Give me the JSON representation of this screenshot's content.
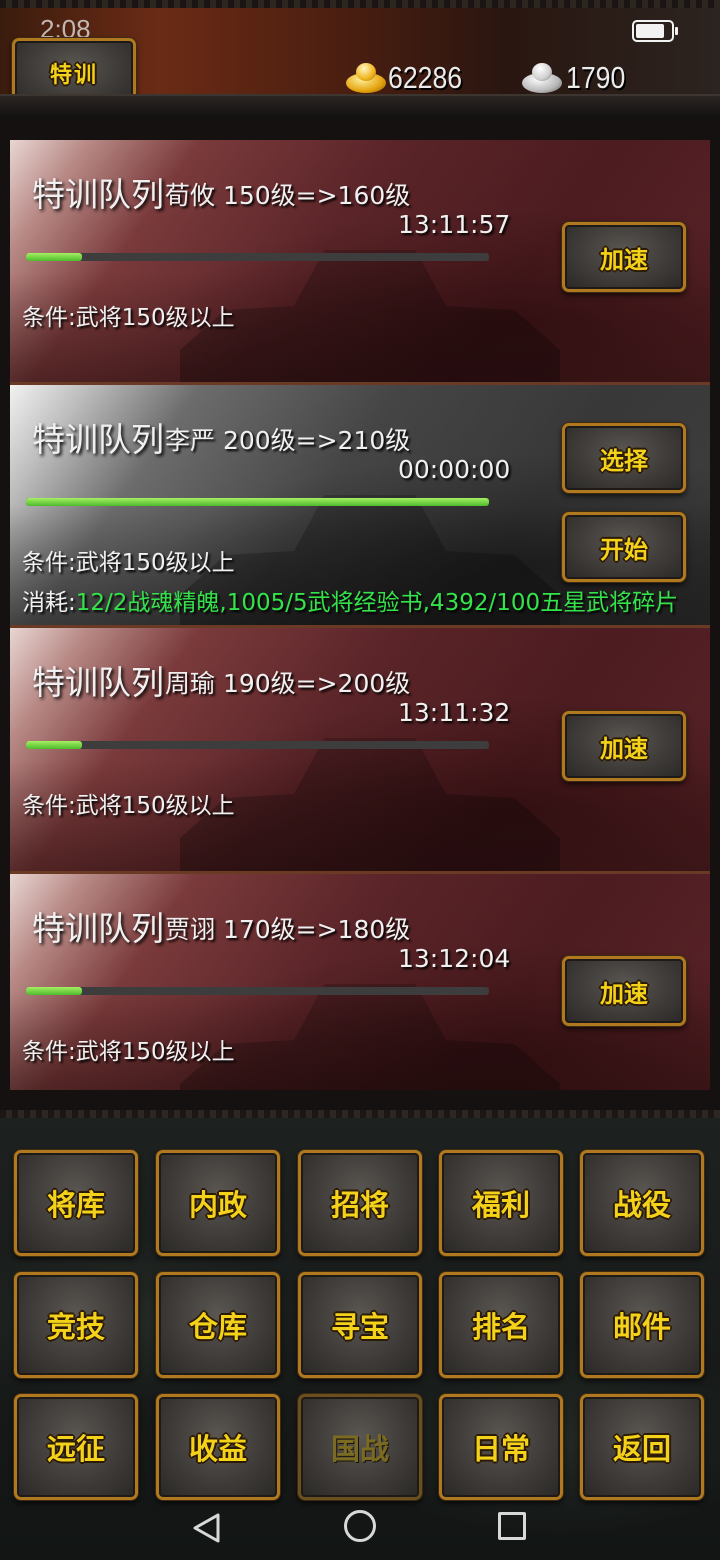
{
  "status_bar": {
    "time": "2:08"
  },
  "header": {
    "tab_label": "特训",
    "gold": "62286",
    "silver": "1790"
  },
  "queues": [
    {
      "title": "特训队列",
      "info": "荀攸 150级=>160级",
      "time": "13:11:57",
      "progress": 0.12,
      "condition": "条件:武将150级以上",
      "button": "加速"
    },
    {
      "title": "特训队列",
      "info": "李严 200级=>210级",
      "time": "00:00:00",
      "progress": 1.0,
      "condition": "条件:武将150级以上",
      "cost_label": "消耗:",
      "cost_value": "12/2战魂精魄,1005/5武将经验书,4392/100五星武将碎片",
      "button_select": "选择",
      "button_start": "开始"
    },
    {
      "title": "特训队列",
      "info": "周瑜 190级=>200级",
      "time": "13:11:32",
      "progress": 0.12,
      "condition": "条件:武将150级以上",
      "button": "加速"
    },
    {
      "title": "特训队列",
      "info": "贾诩 170级=>180级",
      "time": "13:12:04",
      "progress": 0.12,
      "condition": "条件:武将150级以上",
      "button": "加速"
    }
  ],
  "menu": [
    "将库",
    "内政",
    "招将",
    "福利",
    "战役",
    "竞技",
    "仓库",
    "寻宝",
    "排名",
    "邮件",
    "远征",
    "收益",
    "国战",
    "日常",
    "返回"
  ],
  "colors": {
    "button_text": "#f5d21a",
    "button_border": "#b0781f",
    "progress": "#6fd63c",
    "cost_green": "#34e24a"
  }
}
